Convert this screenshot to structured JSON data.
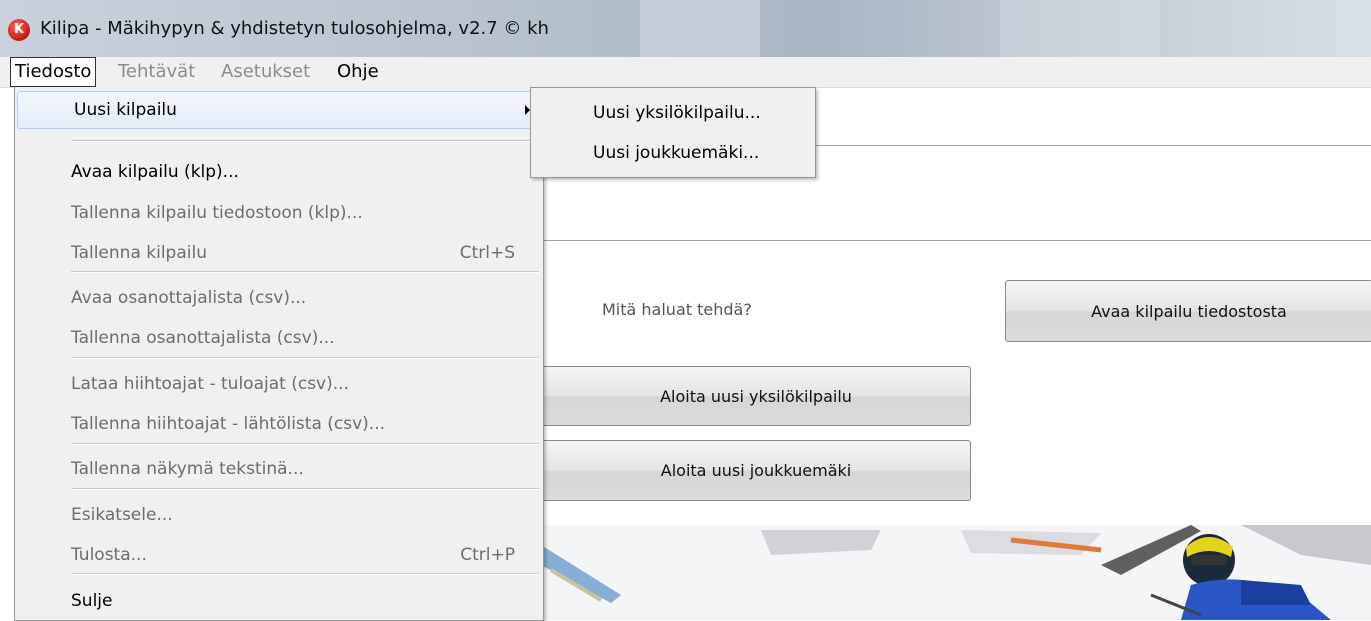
{
  "window": {
    "title": "Kilipa - Mäkihypyn & yhdistetyn tulosohjelma, v2.7 © kh",
    "icon": "app-logo-icon",
    "icon_letter": "K"
  },
  "menubar": {
    "items": [
      {
        "label": "Tiedosto"
      },
      {
        "label": "Tehtävät"
      },
      {
        "label": "Asetukset"
      },
      {
        "label": "Ohje"
      }
    ]
  },
  "file_menu": {
    "items": [
      {
        "label": "Uusi kilpailu",
        "shortcut": ""
      },
      {
        "label": "Avaa kilpailu (klp)...",
        "shortcut": ""
      },
      {
        "label": "Tallenna kilpailu tiedostoon (klp)...",
        "shortcut": ""
      },
      {
        "label": "Tallenna kilpailu",
        "shortcut": "Ctrl+S"
      },
      {
        "label": "Avaa osanottajalista (csv)...",
        "shortcut": ""
      },
      {
        "label": "Tallenna osanottajalista (csv)...",
        "shortcut": ""
      },
      {
        "label": "Lataa hiihtoajat - tuloajat (csv)...",
        "shortcut": ""
      },
      {
        "label": "Tallenna hiihtoajat - lähtölista (csv)...",
        "shortcut": ""
      },
      {
        "label": "Tallenna näkymä tekstinä...",
        "shortcut": ""
      },
      {
        "label": "Esikatsele...",
        "shortcut": ""
      },
      {
        "label": "Tulosta...",
        "shortcut": "Ctrl+P"
      },
      {
        "label": "Sulje",
        "shortcut": ""
      }
    ]
  },
  "submenu": {
    "items": [
      {
        "label": "Uusi yksilökilpailu..."
      },
      {
        "label": "Uusi joukkuemäki..."
      }
    ]
  },
  "main": {
    "question": "Mitä haluat tehdä?",
    "open_button": "Avaa kilpailu tiedostosta",
    "new_individual_button": "Aloita uusi yksilökilpailu",
    "new_team_button": "Aloita uusi joukkuemäki"
  },
  "colors": {
    "menu_bg": "#f0f0f0",
    "hover_border": "#aecff7",
    "disabled_text": "#6d6d6d",
    "icon_red": "#c8140c"
  }
}
